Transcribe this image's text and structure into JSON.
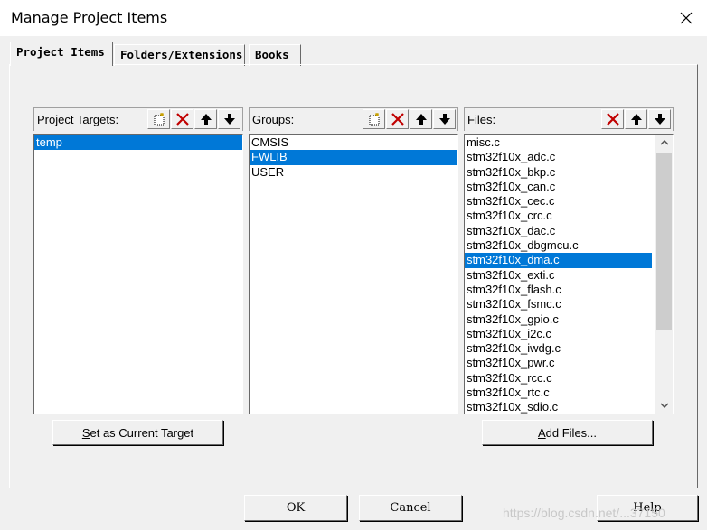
{
  "window": {
    "title": "Manage Project Items"
  },
  "tabs": [
    {
      "label": "Project Items",
      "active": true
    },
    {
      "label": "Folders/Extensions",
      "active": false
    },
    {
      "label": "Books",
      "active": false
    }
  ],
  "targets": {
    "header": "Project Targets:",
    "items": [
      "temp"
    ],
    "selected": "temp"
  },
  "groups": {
    "header": "Groups:",
    "items": [
      "CMSIS",
      "FWLIB",
      "USER"
    ],
    "selected": "FWLIB"
  },
  "files": {
    "header": "Files:",
    "items": [
      "misc.c",
      "stm32f10x_adc.c",
      "stm32f10x_bkp.c",
      "stm32f10x_can.c",
      "stm32f10x_cec.c",
      "stm32f10x_crc.c",
      "stm32f10x_dac.c",
      "stm32f10x_dbgmcu.c",
      "stm32f10x_dma.c",
      "stm32f10x_exti.c",
      "stm32f10x_flash.c",
      "stm32f10x_fsmc.c",
      "stm32f10x_gpio.c",
      "stm32f10x_i2c.c",
      "stm32f10x_iwdg.c",
      "stm32f10x_pwr.c",
      "stm32f10x_rcc.c",
      "stm32f10x_rtc.c",
      "stm32f10x_sdio.c"
    ],
    "selected": "stm32f10x_dma.c"
  },
  "buttons": {
    "set_target_accel": "S",
    "set_target_rest": "et as Current Target",
    "add_files_accel": "A",
    "add_files_rest": "dd Files...",
    "ok": "OK",
    "cancel": "Cancel",
    "help": "Help"
  },
  "watermark": "https://blog.csdn.net/...37150",
  "colors": {
    "selection": "#0078d7",
    "delete_icon": "#c00000"
  }
}
